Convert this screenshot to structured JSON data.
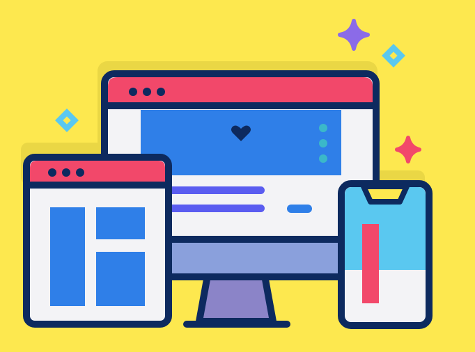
{
  "illustration": {
    "subject": "responsive-web-design",
    "devices": [
      "desktop-monitor",
      "browser-window",
      "smartphone"
    ],
    "decorations": [
      "sparkle-purple",
      "sparkle-red",
      "diamond-blue-top",
      "diamond-blue-left"
    ],
    "colors": {
      "background": "#FDE84F",
      "outline": "#0D2A5F",
      "titlebar": "#F2486A",
      "screen": "#F3F3F6",
      "blue": "#2F7FE8",
      "light_blue": "#5AC8F0",
      "purple": "#8B6BE8",
      "lavender": "#8AA0DC",
      "stand": "#8B84C8",
      "teal_dots": "#3BB8C9",
      "shadow": "#E8D84A"
    }
  }
}
